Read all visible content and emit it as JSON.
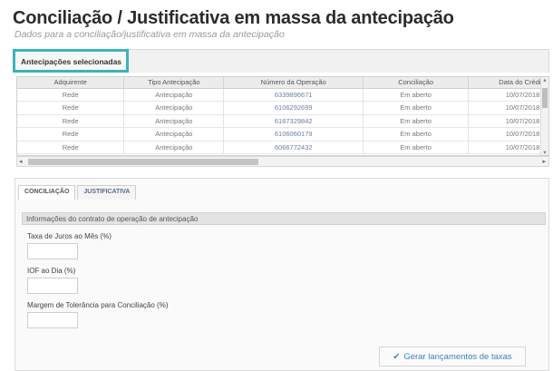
{
  "page": {
    "title": "Conciliação / Justificativa em massa da antecipação",
    "subtitle": "Dados para a conciliação/justificativa em massa da antecipação"
  },
  "section": {
    "tab_label": "Antecipações selecionadas"
  },
  "table": {
    "headers": [
      "Adquirente",
      "Tipo Antecipação",
      "Número da Operação",
      "Conciliação",
      "Data do Crédito"
    ],
    "rows": [
      [
        "Rede",
        "Antecipação",
        "6339896671",
        "Em aberto",
        "10/07/2018"
      ],
      [
        "Rede",
        "Antecipação",
        "6106292699",
        "Em aberto",
        "10/07/2018"
      ],
      [
        "Rede",
        "Antecipação",
        "6167329842",
        "Em aberto",
        "10/07/2018"
      ],
      [
        "Rede",
        "Antecipação",
        "6106060179",
        "Em aberto",
        "10/07/2018"
      ],
      [
        "Rede",
        "Antecipação",
        "6066772432",
        "Em aberto",
        "10/07/2018"
      ]
    ]
  },
  "detail_tabs": {
    "conciliacao": "CONCILIAÇÃO",
    "justificativa": "JUSTIFICATIVA"
  },
  "form": {
    "info_title": "Informações do contrato de operação de antecipação",
    "taxa_label": "Taxa de Juros ao Mês (%)",
    "iof_label": "IOF ao Dia (%)",
    "margem_label": "Margem de Tolerância para Conciliação (%)",
    "taxa_value": "",
    "iof_value": "",
    "margem_value": ""
  },
  "actions": {
    "gerar_label": "Gerar lançamentos de taxas",
    "check_glyph": "✔"
  },
  "scroll": {
    "up": "▲",
    "down": "▼",
    "left": "◂",
    "right": "▸"
  }
}
